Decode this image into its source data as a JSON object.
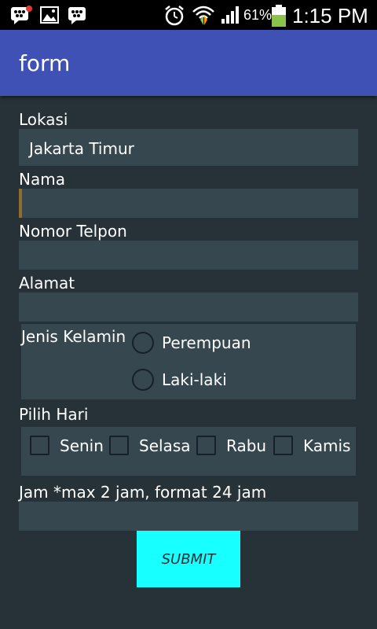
{
  "status_bar": {
    "battery_percent": "61%",
    "time": "1:15 PM",
    "icons": [
      "bbm-notification-icon",
      "image-icon",
      "bbm-icon",
      "alarm-icon",
      "wifi-icon",
      "signal-icon",
      "battery-icon"
    ],
    "battery_color": "#8bc34a"
  },
  "app_bar": {
    "title": "form",
    "color": "#3f51b5"
  },
  "form": {
    "lokasi_label": "Lokasi",
    "lokasi_value": "Jakarta Timur",
    "nama_label": "Nama",
    "nama_value": "",
    "telpon_label": "Nomor Telpon",
    "telpon_value": "",
    "alamat_label": "Alamat",
    "alamat_value": "",
    "gender": {
      "label": "Jenis Kelamin",
      "options": [
        {
          "label": "Perempuan",
          "selected": false
        },
        {
          "label": "Laki-laki",
          "selected": false
        }
      ]
    },
    "days": {
      "label": "Pilih Hari",
      "options": [
        {
          "label": "Senin",
          "checked": false
        },
        {
          "label": "Selasa",
          "checked": false
        },
        {
          "label": "Rabu",
          "checked": false
        },
        {
          "label": "Kamis",
          "checked": false
        }
      ]
    },
    "jam_label": "Jam *max 2 jam, format 24 jam",
    "jam_value": "",
    "submit_label": "SUBMIT",
    "submit_color": "#18ffff"
  }
}
